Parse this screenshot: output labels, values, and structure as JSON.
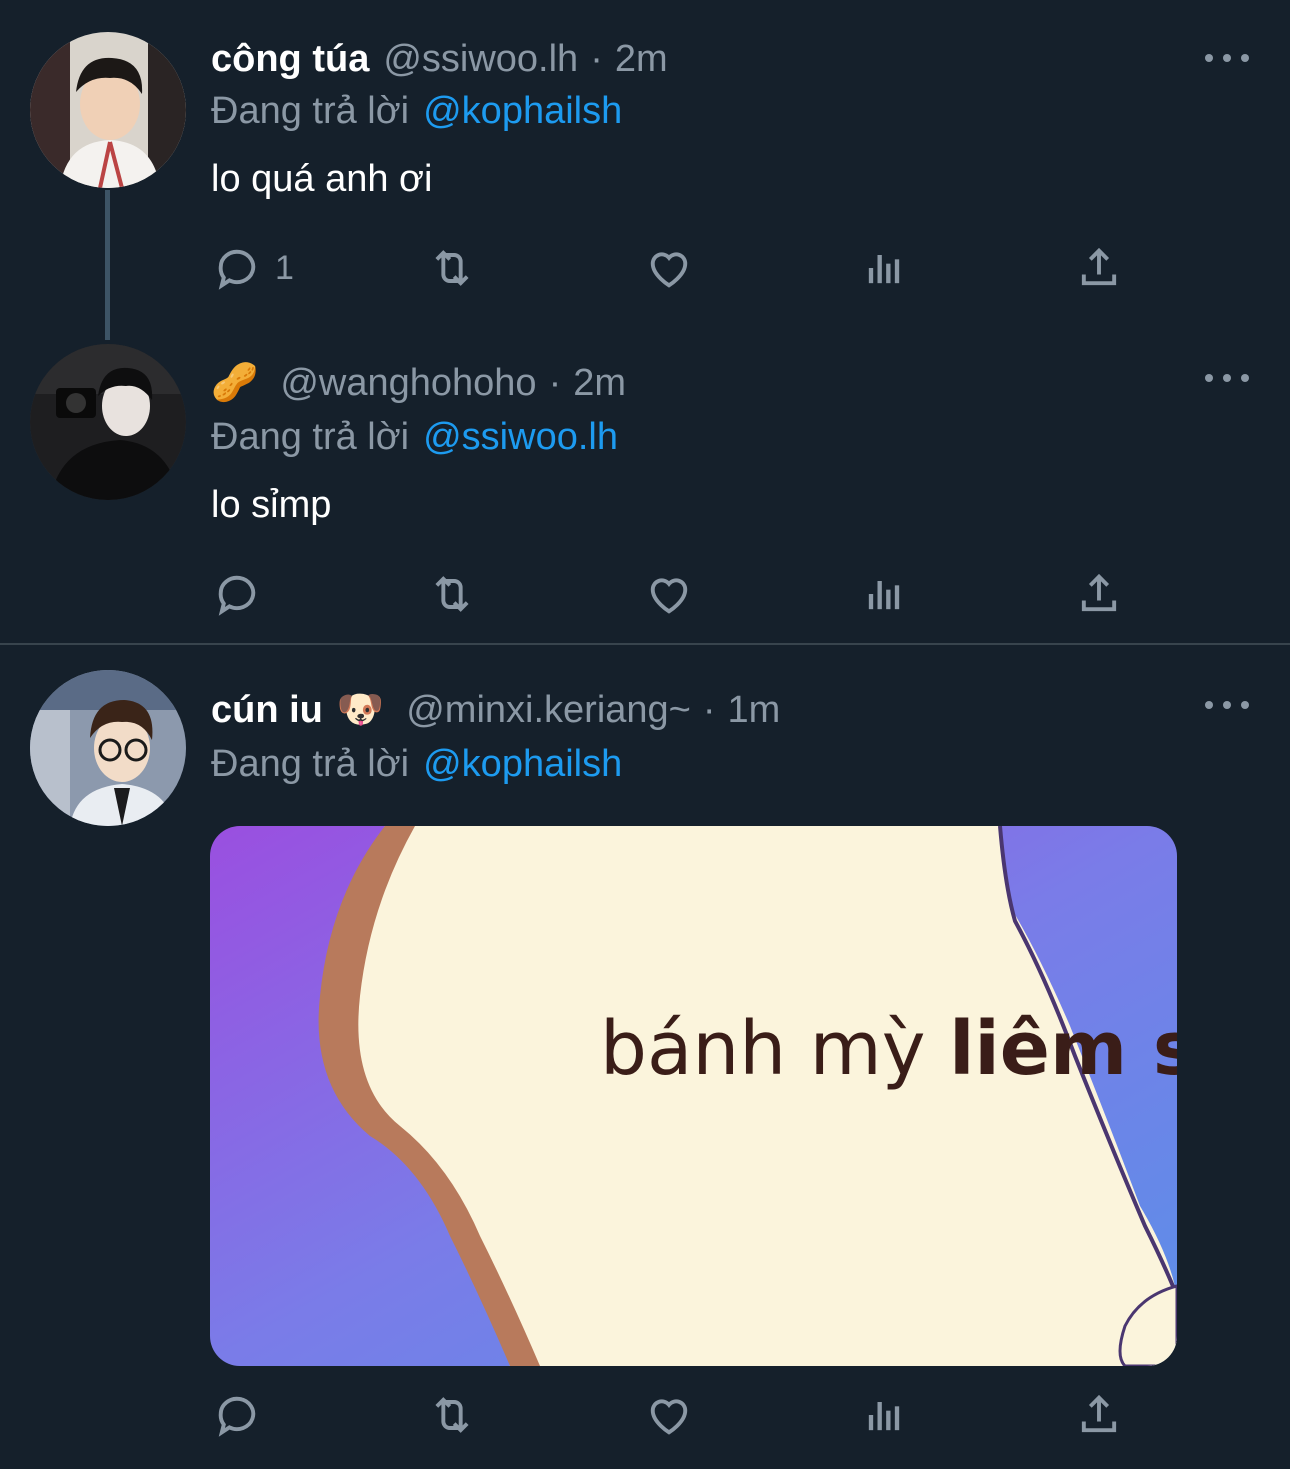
{
  "tweets": [
    {
      "display_name": "công túa",
      "handle": "@ssiwoo.lh",
      "separator": "·",
      "time": "2m",
      "reply_prefix": "Đang trả lời",
      "reply_to": "@kophailsh",
      "text": "lo quá anh ơi",
      "reply_count": "1"
    },
    {
      "display_name_emoji": "🥜",
      "handle": "@wanghohoho",
      "separator": "·",
      "time": "2m",
      "reply_prefix": "Đang trả lời",
      "reply_to": "@ssiwoo.lh",
      "text": "lo sỉmp",
      "reply_count": ""
    },
    {
      "display_name": "cún iu",
      "display_name_emoji": "🐶",
      "handle": "@minxi.keriang~",
      "separator": "·",
      "time": "1m",
      "reply_prefix": "Đang trả lời",
      "reply_to": "@kophailsh",
      "media": {
        "caption_part1": "bánh mỳ",
        "caption_part2": "liêm sỉ"
      },
      "reply_count": ""
    }
  ],
  "icons": [
    "reply-icon",
    "retweet-icon",
    "like-icon",
    "analytics-icon",
    "share-icon",
    "more-icon"
  ],
  "colors": {
    "background": "#15202b",
    "secondary_text": "#8b98a5",
    "link": "#1d9bf0",
    "divider": "#38444d"
  }
}
